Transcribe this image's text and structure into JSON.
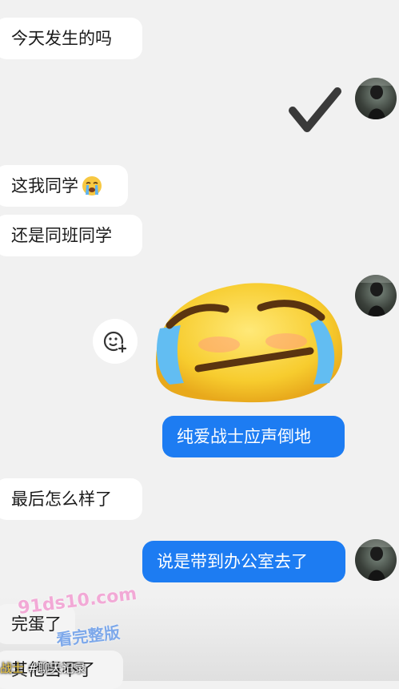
{
  "messages": [
    {
      "text": "今天发生的吗"
    },
    {
      "text": "这我同学"
    },
    {
      "text": "还是同班同学"
    },
    {
      "text": "纯爱战士应声倒地"
    },
    {
      "text": "最后怎么样了"
    },
    {
      "text": "说是带到办公室去了"
    },
    {
      "text": "完蛋了"
    },
    {
      "text": "其他当不了"
    }
  ],
  "watermark": {
    "site": "91ds10.com",
    "slogan": "看完整版"
  },
  "caption": {
    "prefix": "战士",
    "tag": " #聊天记录"
  },
  "icons": [
    "check-icon",
    "crying-emoji-icon",
    "add-reaction-icon",
    "avatar"
  ],
  "colors": {
    "outgoing": "#1d7cf2",
    "incoming": "#ffffff",
    "background": "#f1f1f1"
  }
}
